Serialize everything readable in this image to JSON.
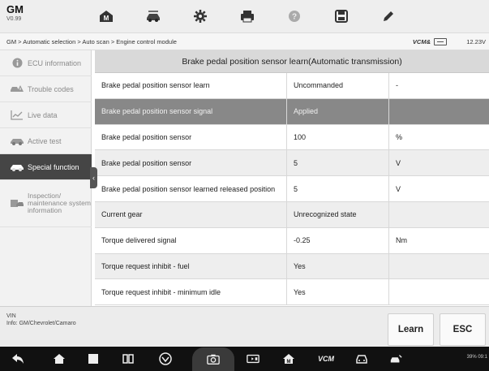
{
  "app": {
    "name": "GM",
    "version": "V0.99"
  },
  "toolbar": {
    "icons": [
      "home-icon",
      "vehicle-swap-icon",
      "settings-icon",
      "print-icon",
      "help-icon",
      "save-icon",
      "edit-icon"
    ]
  },
  "breadcrumb": "GM > Automatic selection > Auto scan > Engine control module",
  "status_bar": {
    "vcm_label": "VCM&",
    "voltage": "12.23V"
  },
  "sidebar": {
    "items": [
      {
        "label": "ECU information",
        "icon": "info-icon"
      },
      {
        "label": "Trouble codes",
        "icon": "car-warning-icon"
      },
      {
        "label": "Live data",
        "icon": "live-data-icon"
      },
      {
        "label": "Active test",
        "icon": "active-test-icon"
      },
      {
        "label": "Special function",
        "icon": "special-function-icon"
      },
      {
        "label": "Inspection/ maintenance system information",
        "icon": "inspection-icon"
      }
    ]
  },
  "table": {
    "title": "Brake pedal position sensor learn(Automatic transmission)",
    "rows": [
      {
        "name": "Brake pedal position sensor learn",
        "value": "Uncommanded",
        "unit": "-"
      },
      {
        "name": "Brake pedal position sensor signal",
        "value": "Applied",
        "unit": ""
      },
      {
        "name": "Brake pedal position sensor",
        "value": "100",
        "unit": "%"
      },
      {
        "name": "Brake pedal position sensor",
        "value": "5",
        "unit": "V"
      },
      {
        "name": "Brake pedal position sensor learned released position",
        "value": "5",
        "unit": "V"
      },
      {
        "name": "Current gear",
        "value": "Unrecognized state",
        "unit": ""
      },
      {
        "name": "Torque delivered signal",
        "value": "-0.25",
        "unit": "Nm"
      },
      {
        "name": "Torque request inhibit - fuel",
        "value": "Yes",
        "unit": ""
      },
      {
        "name": "Torque request inhibit - minimum idle",
        "value": "Yes",
        "unit": ""
      }
    ]
  },
  "footer": {
    "vin_label": "VIN",
    "info": "Info: GM/Chevrolet/Camaro",
    "learn_label": "Learn",
    "esc_label": "ESC"
  },
  "android_nav": {
    "vcm_label": "VCM",
    "status": "39% 09:1"
  },
  "colors": {
    "sidebar_active": "#454545",
    "row_selected": "#888888",
    "title_bar": "#d9d9d9"
  }
}
